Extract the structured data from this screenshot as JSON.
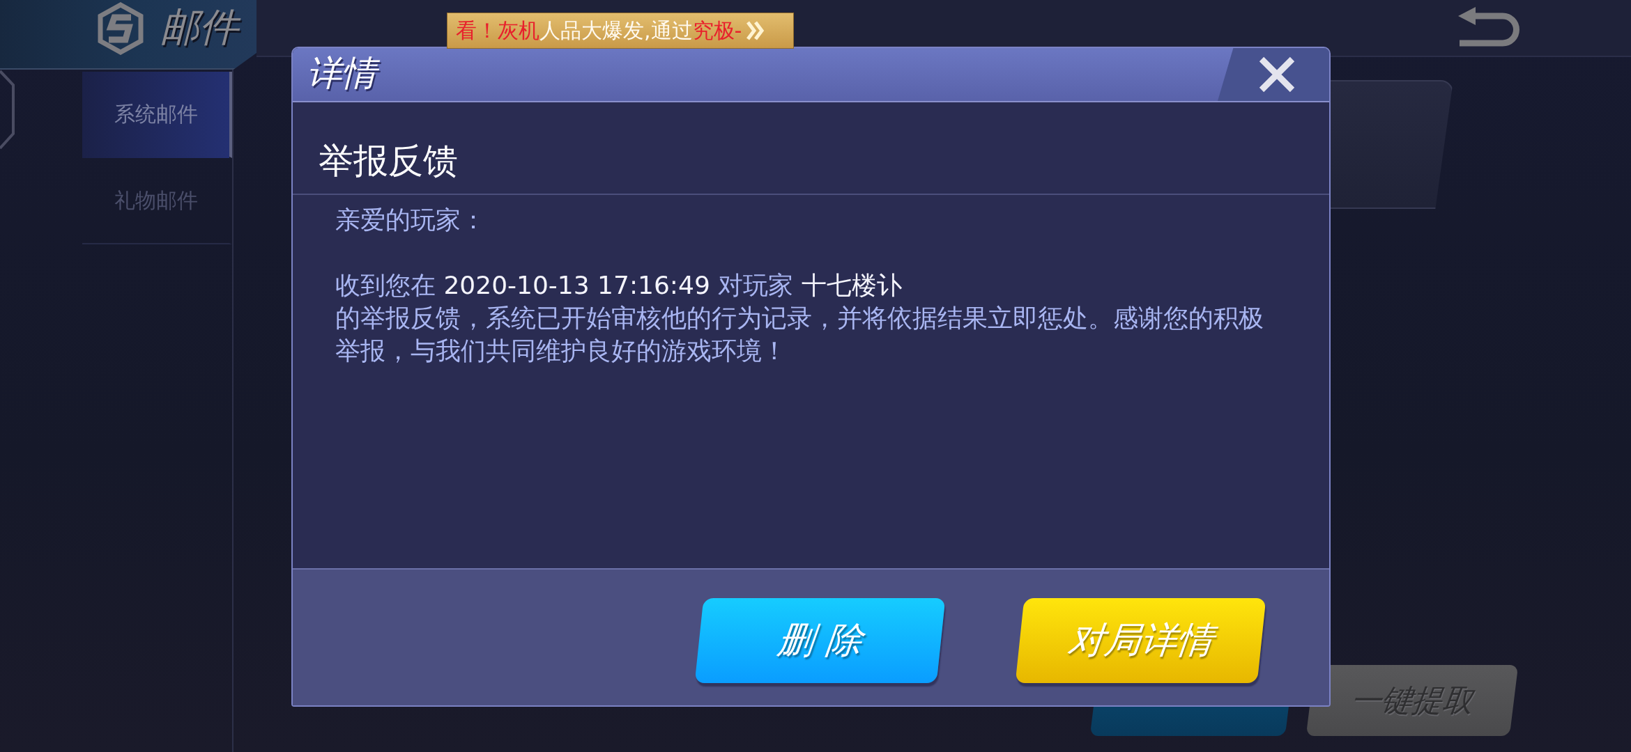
{
  "header": {
    "title": "邮件"
  },
  "banner": {
    "segments": [
      {
        "text": "看！灰机",
        "emphasis": true
      },
      {
        "text": "人品大爆发,通过",
        "emphasis": false
      },
      {
        "text": "究极-",
        "emphasis": true
      }
    ]
  },
  "sidebar": {
    "items": [
      {
        "label": "系统邮件",
        "selected": true
      },
      {
        "label": "礼物邮件",
        "selected": false
      }
    ]
  },
  "actions": [
    {
      "kind": "primary"
    },
    {
      "label": "一键提取",
      "kind": "secondary"
    }
  ],
  "dialog": {
    "title": "详情",
    "heading": "举报反馈",
    "greeting": "亲爱的玩家：",
    "lines": [
      [
        {
          "text": "收到您在 ",
          "emphasis": false
        },
        {
          "text": "2020-10-13 17:16:49",
          "emphasis": true
        },
        {
          "text": " 对玩家 ",
          "emphasis": false
        },
        {
          "text": "十七楼讣",
          "emphasis": true
        }
      ],
      [
        {
          "text": "的举报反馈，系统已开始审核他的行为记录，并将依据结果立即惩处。感谢您的积极",
          "emphasis": false
        }
      ],
      [
        {
          "text": "举报，与我们共同维护良好的游戏环境！",
          "emphasis": false
        }
      ]
    ],
    "buttons": [
      {
        "label": "删 除",
        "kind": "primary"
      },
      {
        "label": "对局详情",
        "kind": "accent"
      }
    ]
  }
}
